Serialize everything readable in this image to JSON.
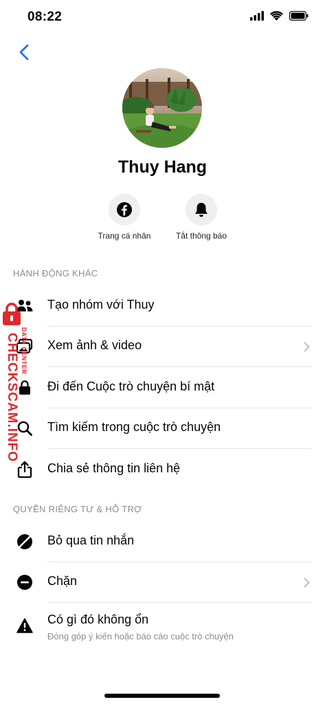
{
  "status_bar": {
    "time": "08:22"
  },
  "profile": {
    "name": "Thuy Hang"
  },
  "quick_actions": [
    {
      "label": "Trang cá nhân",
      "icon": "facebook-icon"
    },
    {
      "label": "Tắt thông báo",
      "icon": "bell-icon"
    }
  ],
  "sections": {
    "other_actions": {
      "header": "HÀNH ĐỘNG KHÁC",
      "items": [
        {
          "label": "Tạo nhóm với Thuy",
          "icon": "group-icon"
        },
        {
          "label": "Xem ảnh & video",
          "icon": "media-icon"
        },
        {
          "label": "Đi đến Cuộc trò chuyện bí mật",
          "icon": "lock-chat-icon"
        },
        {
          "label": "Tìm kiếm trong cuộc trò chuyện",
          "icon": "search-icon"
        },
        {
          "label": "Chia sẻ thông tin liên hệ",
          "icon": "share-icon"
        }
      ]
    },
    "privacy": {
      "header": "QUYỀN RIÊNG TƯ & HỖ TRỢ",
      "items": [
        {
          "label": "Bỏ qua tin nhắn",
          "icon": "ignore-icon"
        },
        {
          "label": "Chặn",
          "icon": "block-icon"
        },
        {
          "label": "Có gì đó không ổn",
          "sublabel": "Đóng góp ý kiến hoặc báo cáo cuộc trò chuyện",
          "icon": "warning-icon"
        }
      ]
    }
  },
  "watermark": {
    "text": "CHECKSCAM.INFO",
    "small_text": "DATA CENTER"
  },
  "colors": {
    "accent": "#1877f2",
    "watermark": "#e0282e",
    "secondary_text": "#8a8d91"
  }
}
